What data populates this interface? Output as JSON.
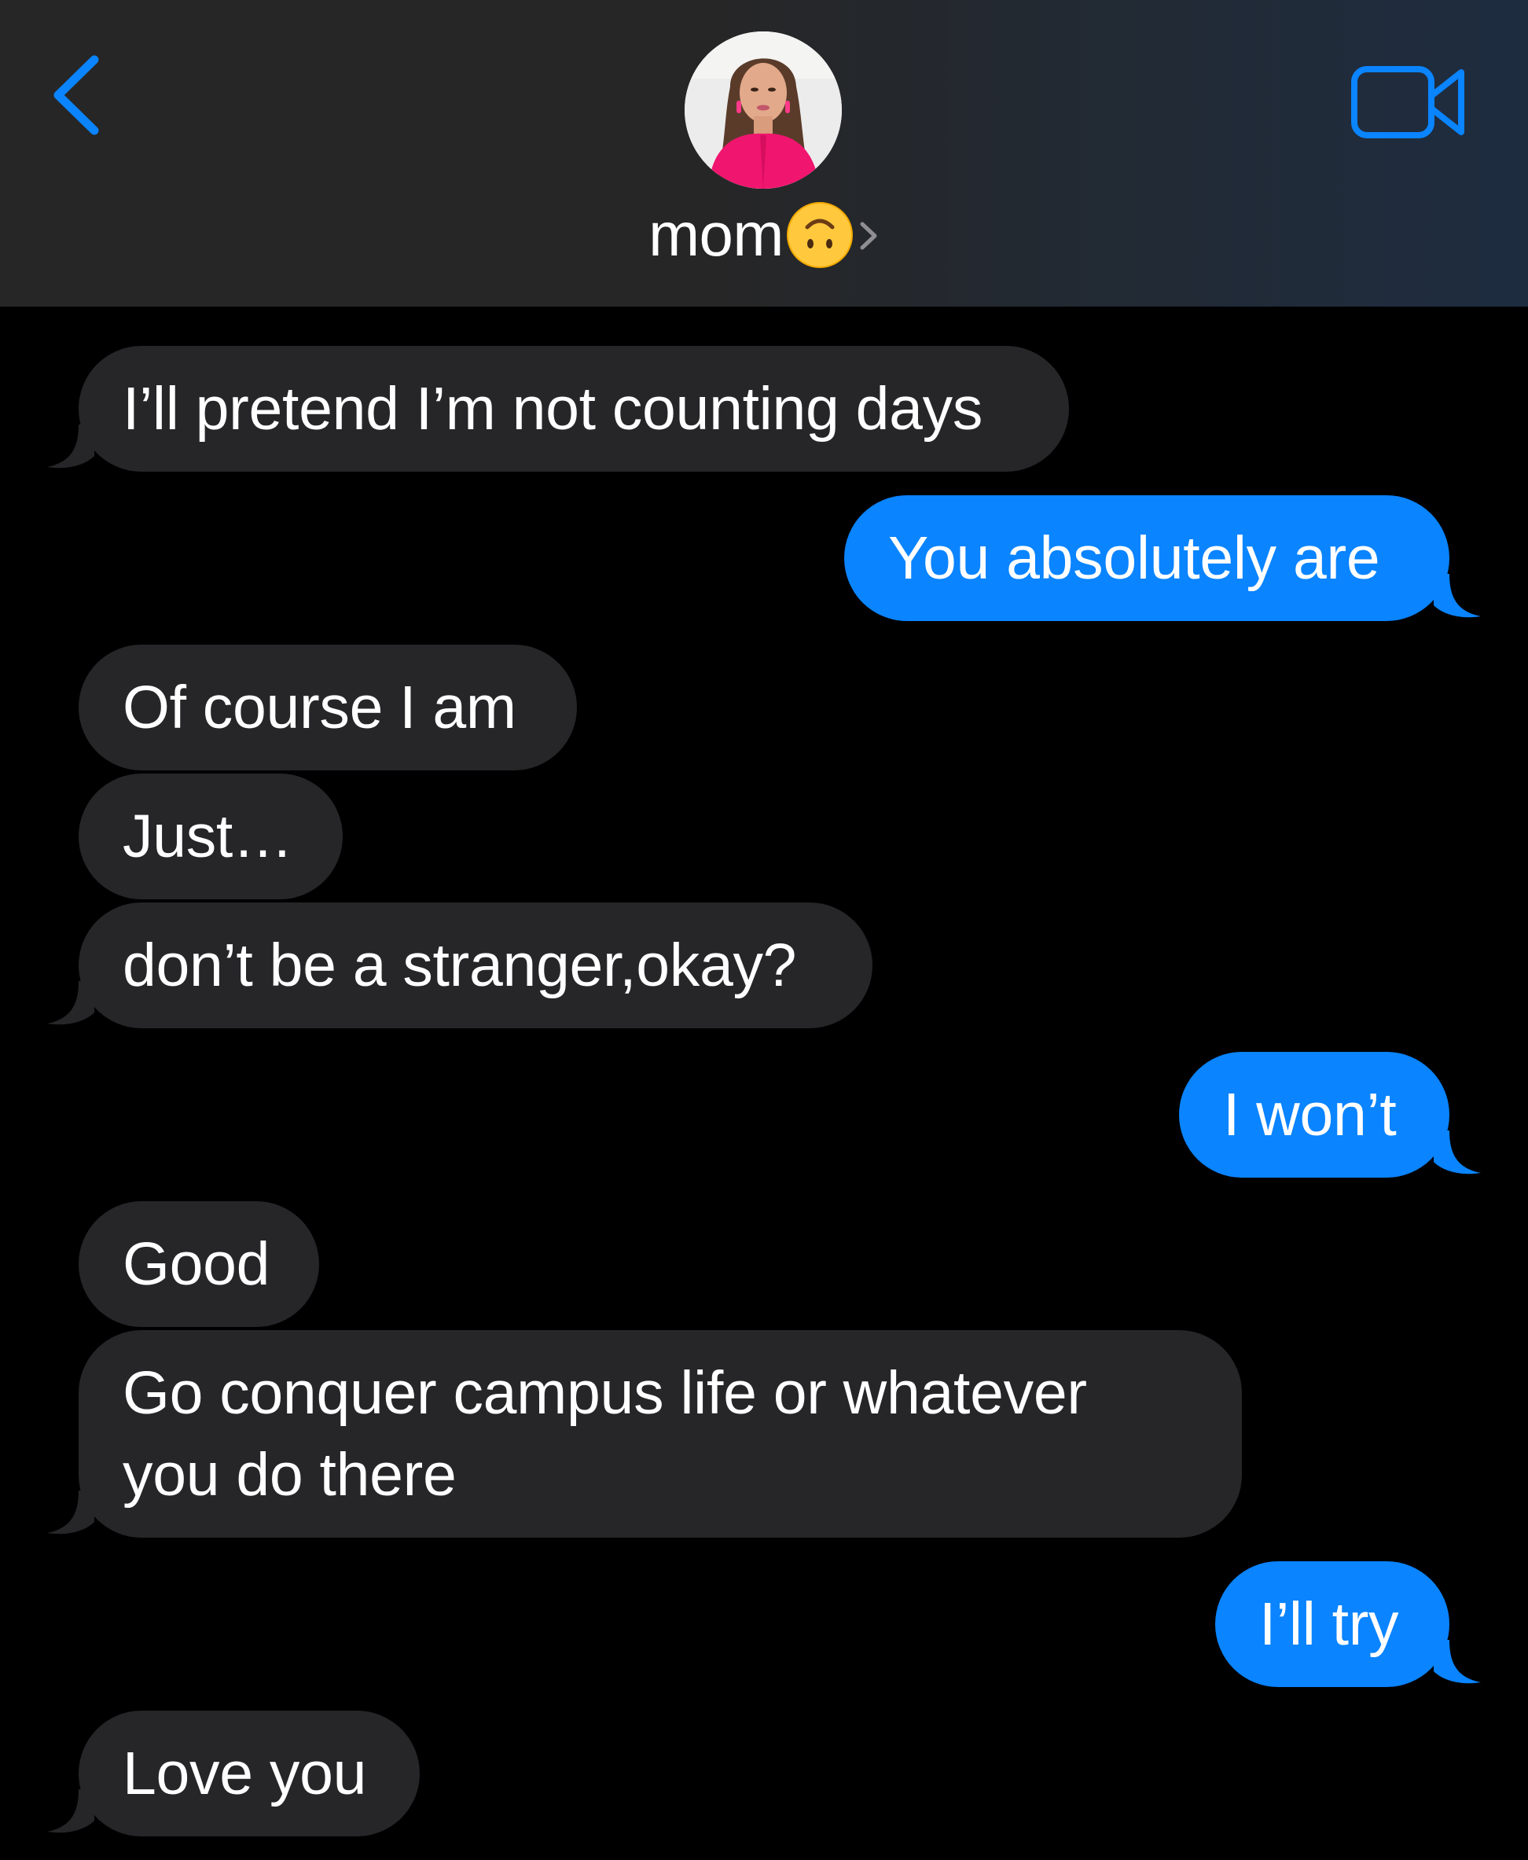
{
  "header": {
    "back_icon": "chevron-left-icon",
    "video_icon": "video-camera-icon",
    "contact_name": "mom",
    "contact_emoji": "upside-down-face-emoji",
    "chevron_icon": "chevron-right-icon",
    "accent_color": "#0a84ff"
  },
  "messages": [
    {
      "direction": "in",
      "text": "I’ll pretend I’m not counting days"
    },
    {
      "direction": "out",
      "text": "You absolutely are"
    },
    {
      "direction": "in",
      "text": "Of course I am"
    },
    {
      "direction": "in",
      "text": "Just…"
    },
    {
      "direction": "in",
      "text": "don’t be a stranger,okay?"
    },
    {
      "direction": "out",
      "text": "I won’t"
    },
    {
      "direction": "in",
      "text": "Good"
    },
    {
      "direction": "in",
      "text": "Go conquer campus life or whatever you do there"
    },
    {
      "direction": "out",
      "text": "I’ll try"
    },
    {
      "direction": "in",
      "text": "Love you"
    }
  ],
  "colors": {
    "incoming_bubble": "#262629",
    "outgoing_bubble": "#0a84ff",
    "background": "#000000"
  }
}
